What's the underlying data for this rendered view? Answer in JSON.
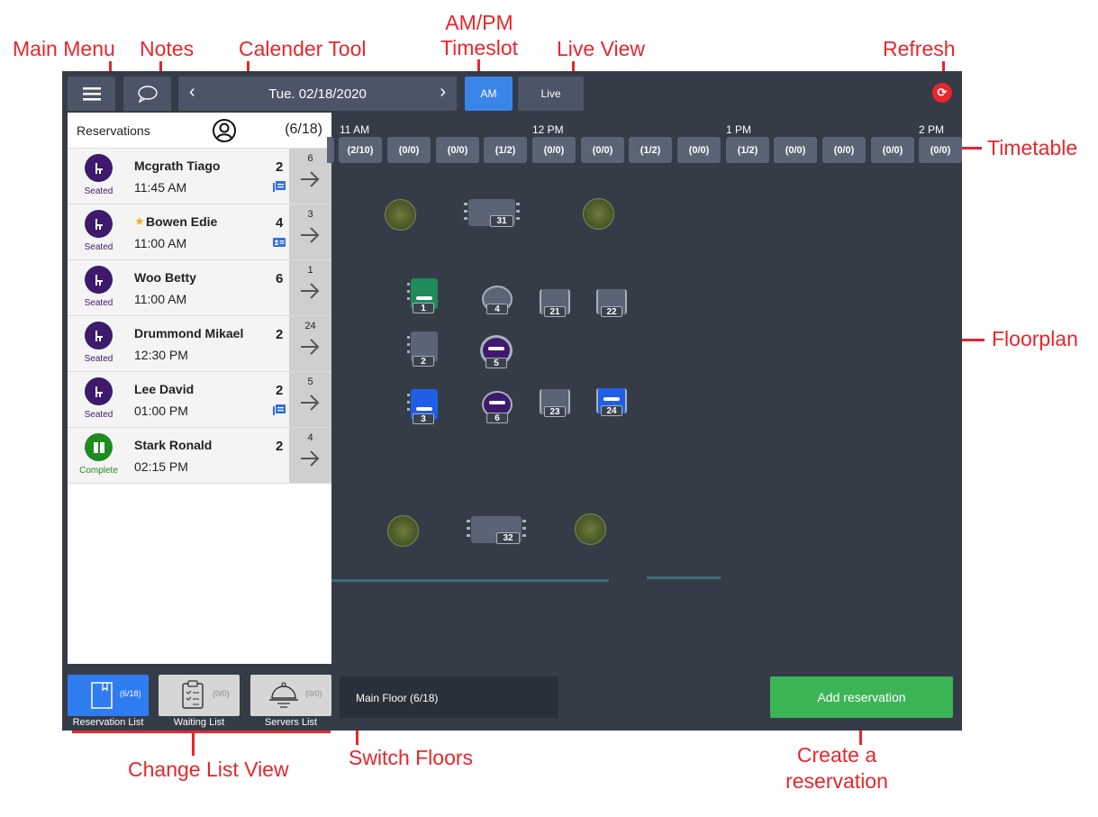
{
  "callouts": {
    "main_menu": "Main Menu",
    "notes": "Notes",
    "calendar_tool": "Calender Tool",
    "ampm_line1": "AM/PM",
    "ampm_line2": "Timeslot",
    "live_view": "Live View",
    "refresh": "Refresh",
    "timetable": "Timetable",
    "floorplan": "Floorplan",
    "change_list_view": "Change List View",
    "switch_floors": "Switch Floors",
    "create_line1": "Create a",
    "create_line2": "reservation"
  },
  "toolbar": {
    "date": "Tue. 02/18/2020",
    "prev": "‹",
    "next": "›",
    "am": "AM",
    "live": "Live",
    "menu_icon": "hamburger-icon",
    "notes_icon": "speech-bubble-icon",
    "refresh_icon": "refresh-icon"
  },
  "reservations": {
    "title": "Reservations",
    "count": "(6/18)",
    "items": [
      {
        "name": "Mcgrath Tiago",
        "time": "11:45 AM",
        "party": "2",
        "table": "6",
        "status": "Seated",
        "note": true,
        "star": false
      },
      {
        "name": "Bowen Edie",
        "time": "11:00 AM",
        "party": "4",
        "table": "3",
        "status": "Seated",
        "note": false,
        "card": true,
        "star": true
      },
      {
        "name": "Woo Betty",
        "time": "11:00 AM",
        "party": "6",
        "table": "1",
        "status": "Seated",
        "note": false,
        "star": false
      },
      {
        "name": "Drummond Mikael",
        "time": "12:30 PM",
        "party": "2",
        "table": "24",
        "status": "Seated",
        "note": false,
        "star": false
      },
      {
        "name": "Lee David",
        "time": "01:00 PM",
        "party": "2",
        "table": "5",
        "status": "Seated",
        "note": true,
        "star": false
      },
      {
        "name": "Stark Ronald",
        "time": "02:15 PM",
        "party": "2",
        "table": "4",
        "status": "Complete",
        "note": false,
        "star": false
      }
    ]
  },
  "timeline": {
    "hours": [
      "11 AM",
      "12 PM",
      "1 PM",
      "2 PM"
    ],
    "slots": [
      "(2/10)",
      "(0/0)",
      "(0/0)",
      "(1/2)",
      "(0/0)",
      "(0/0)",
      "(1/2)",
      "(0/0)",
      "(1/2)",
      "(0/0)",
      "(0/0)",
      "(0/0)",
      "(0/0)"
    ]
  },
  "tables": [
    "31",
    "1",
    "4",
    "21",
    "22",
    "2",
    "5",
    "3",
    "6",
    "23",
    "24",
    "32"
  ],
  "bottom": {
    "reservation_list": "Reservation List",
    "reservation_count": "(6/18)",
    "waiting_list": "Waiting List",
    "waiting_count": "(0/0)",
    "servers_list": "Servers List",
    "servers_count": "(0/0)",
    "floor": "Main Floor (6/18)",
    "add": "Add reservation"
  },
  "colors": {
    "accent_blue": "#3a86e8",
    "seated_purple": "#3d1a6b",
    "complete_green": "#1f8a1f",
    "add_green": "#3cb557",
    "callout_red": "#e8262b"
  }
}
